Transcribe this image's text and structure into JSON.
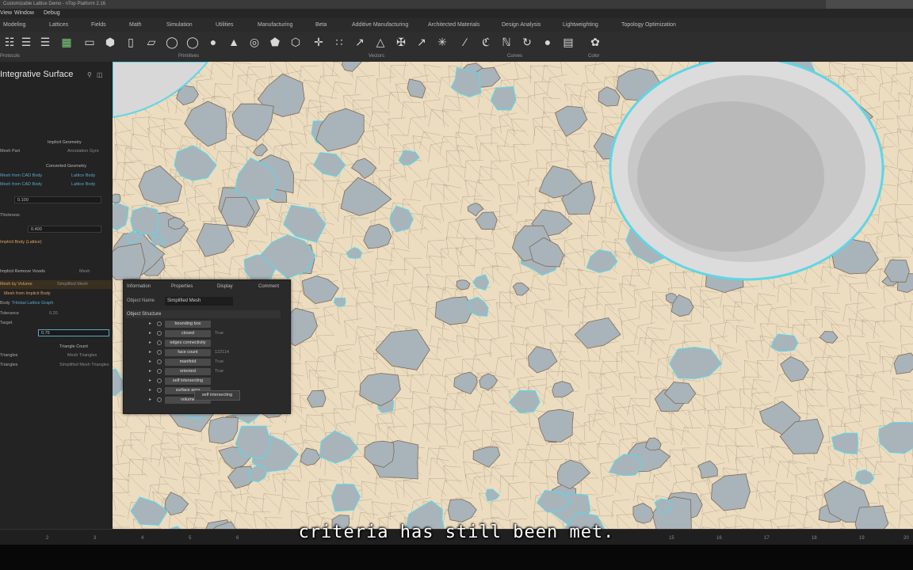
{
  "titlebar": {
    "text": "Customizable Lattice Demo - nTop Platform 2.16"
  },
  "menu": [
    "View",
    "Window",
    "Debug"
  ],
  "ribbon_tabs": [
    "Modeling",
    "Lattices",
    "Fields",
    "Math",
    "Simulation",
    "Utilities",
    "Manufacturing",
    "Beta",
    "Additive Manufacturing",
    "Architected Materials",
    "Design Analysis",
    "Lightweighting",
    "Topology Optimization"
  ],
  "toolbar_groups": {
    "primitives": "Primitives",
    "vectors": "Vectors",
    "curves": "Curves",
    "color": "Color",
    "protocols": "Protocols"
  },
  "left_panel": {
    "title": "Integrative Surface",
    "rows": [
      {
        "label": "Implicit Geometry",
        "value": ""
      },
      {
        "label": "Mesh Part",
        "value": "Annotation Gyro"
      },
      {
        "label": "Converted Geometry",
        "value": ""
      },
      {
        "label": "Mesh from CAD Body",
        "value": "Lattice Body"
      },
      {
        "label": "Mesh from CAD Body",
        "value": "Lattice Body"
      },
      {
        "label": "Tolerance",
        "value": "0.100"
      },
      {
        "label": "Thickness",
        "value": "0.400"
      },
      {
        "label": "Implicit Body (Lattice)",
        "value": ""
      },
      {
        "label": "Implicit Remove Voxels",
        "value": "Mesh"
      },
      {
        "label": "Mesh by Volume",
        "value": "Simplified Mesh"
      },
      {
        "label": "Mesh from Implicit Body",
        "value": ""
      },
      {
        "label": "Body",
        "value": "Trilobal Lattice Graph"
      },
      {
        "label": "Tolerance",
        "value": "0.20"
      },
      {
        "label": "Target",
        "value": ""
      },
      {
        "label": "Tol",
        "value": "0.75"
      },
      {
        "label": "Triangle Count",
        "value": ""
      },
      {
        "label": "Triangles",
        "value": "Mesh Triangles"
      },
      {
        "label": "Triangles",
        "value": "Simplified Mesh Triangles"
      }
    ]
  },
  "info_panel": {
    "tabs": [
      "Information",
      "Properties",
      "Display",
      "Comment"
    ],
    "object_name_label": "Object Name",
    "object_name_value": "Simplified Mesh",
    "structure_label": "Object Structure",
    "tree": [
      {
        "label": "bounding box",
        "value": ""
      },
      {
        "label": "closed",
        "value": "True"
      },
      {
        "label": "edges connectivity",
        "value": ""
      },
      {
        "label": "face count",
        "value": "122114"
      },
      {
        "label": "manifold",
        "value": "True"
      },
      {
        "label": "oriented",
        "value": "True"
      },
      {
        "label": "self intersecting",
        "value": ""
      },
      {
        "label": "surface area",
        "value": ""
      },
      {
        "label": "volume",
        "value": ""
      }
    ],
    "tooltip": "self intersecting"
  },
  "ruler": [
    "2",
    "3",
    "4",
    "5",
    "6",
    "15",
    "16",
    "17",
    "18",
    "19",
    "20"
  ],
  "subtitle": "criteria has still been met.",
  "colors": {
    "lattice": "#ecdcc0",
    "holes": "#a9b3ba",
    "edge_highlight": "#5fd6e6",
    "panel": "#232323"
  }
}
